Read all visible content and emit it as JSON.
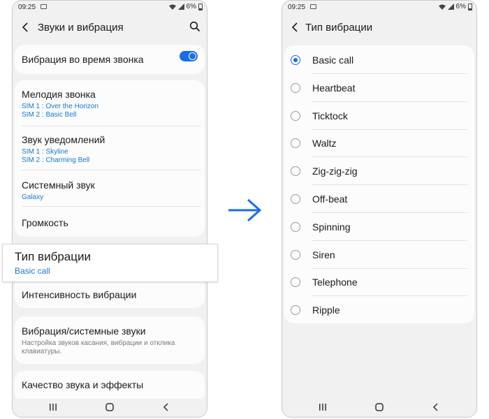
{
  "left_screen": {
    "status": {
      "time": "09:25",
      "battery": "6%"
    },
    "title": "Звуки и вибрация",
    "vibrate_while_ringing": {
      "label": "Вибрация во время звонка",
      "enabled": true
    },
    "ringtone": {
      "label": "Мелодия звонка",
      "sim1": "SIM 1 : Over the Horizon",
      "sim2": "SIM 2 : Basic Bell"
    },
    "notification_sound": {
      "label": "Звук уведомлений",
      "sim1": "SIM 1 : Skyline",
      "sim2": "SIM 2 : Charming Bell"
    },
    "system_sound": {
      "label": "Системный звук",
      "value": "Galaxy"
    },
    "volume": {
      "label": "Громкость"
    },
    "vibration_pattern": {
      "label": "Тип вибрации",
      "value": "Basic call"
    },
    "vibration_intensity": {
      "label": "Интенсивность вибрации"
    },
    "vibration_system_sounds": {
      "label": "Вибрация/системные звуки",
      "desc1": "Настройка звуков касания, вибрации и отклика",
      "desc2": "клавиатуры."
    },
    "sound_quality": {
      "label": "Качество звука и эффекты"
    }
  },
  "right_screen": {
    "status": {
      "time": "09:25",
      "battery": "6%"
    },
    "title": "Тип вибрации",
    "selected": "Basic call",
    "options": [
      "Basic call",
      "Heartbeat",
      "Ticktock",
      "Waltz",
      "Zig-zig-zig",
      "Off-beat",
      "Spinning",
      "Siren",
      "Telephone",
      "Ripple"
    ]
  },
  "colors": {
    "accent": "#1a6ee0",
    "link": "#1877d1",
    "background": "#f1f1f1"
  }
}
